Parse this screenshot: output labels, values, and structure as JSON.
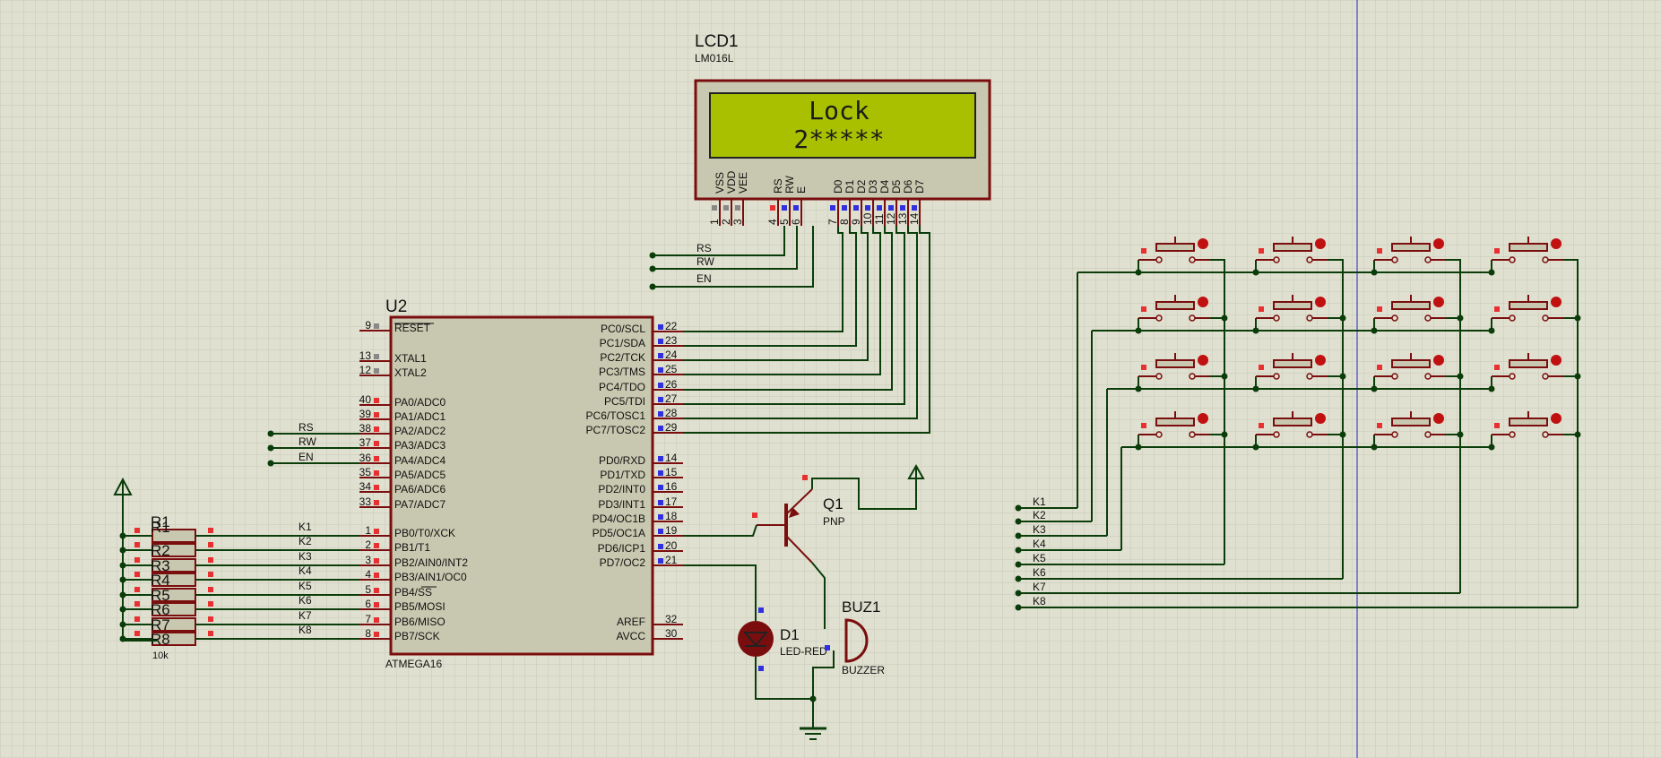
{
  "colors": {
    "background": "#e0e0d0",
    "grid": "#c9c9b8",
    "wire": "#0a3d0a",
    "component": "#7a0e0e",
    "chip_fill": "#c8c8b0",
    "lcd_screen": "#a8c000",
    "pin_red": "#e83030",
    "pin_blue": "#3030e0",
    "pin_gray": "#888888",
    "cursor_line": "#2222cc"
  },
  "lcd": {
    "ref": "LCD1",
    "part": "LM016L",
    "line1": "Lock",
    "line2": "2*****",
    "pin_names": [
      "VSS",
      "VDD",
      "VEE",
      "RS",
      "RW",
      "E",
      "D0",
      "D1",
      "D2",
      "D3",
      "D4",
      "D5",
      "D6",
      "D7"
    ],
    "pin_numbers": [
      "1",
      "2",
      "3",
      "4",
      "5",
      "6",
      "7",
      "8",
      "9",
      "10",
      "11",
      "12",
      "13",
      "14"
    ],
    "net_labels": [
      "RS",
      "RW",
      "EN"
    ]
  },
  "mcu": {
    "ref": "U2",
    "part": "ATMEGA16",
    "left_pins": [
      {
        "num": "9",
        "name": "RESET"
      },
      {
        "num": "13",
        "name": "XTAL1"
      },
      {
        "num": "12",
        "name": "XTAL2"
      },
      {
        "num": "40",
        "name": "PA0/ADC0"
      },
      {
        "num": "39",
        "name": "PA1/ADC1"
      },
      {
        "num": "38",
        "name": "PA2/ADC2"
      },
      {
        "num": "37",
        "name": "PA3/ADC3"
      },
      {
        "num": "36",
        "name": "PA4/ADC4"
      },
      {
        "num": "35",
        "name": "PA5/ADC5"
      },
      {
        "num": "34",
        "name": "PA6/ADC6"
      },
      {
        "num": "33",
        "name": "PA7/ADC7"
      },
      {
        "num": "1",
        "name": "PB0/T0/XCK"
      },
      {
        "num": "2",
        "name": "PB1/T1"
      },
      {
        "num": "3",
        "name": "PB2/AIN0/INT2"
      },
      {
        "num": "4",
        "name": "PB3/AIN1/OC0"
      },
      {
        "num": "5",
        "name": "PB4/SS"
      },
      {
        "num": "6",
        "name": "PB5/MOSI"
      },
      {
        "num": "7",
        "name": "PB6/MISO"
      },
      {
        "num": "8",
        "name": "PB7/SCK"
      }
    ],
    "right_pins": [
      {
        "num": "22",
        "name": "PC0/SCL"
      },
      {
        "num": "23",
        "name": "PC1/SDA"
      },
      {
        "num": "24",
        "name": "PC2/TCK"
      },
      {
        "num": "25",
        "name": "PC3/TMS"
      },
      {
        "num": "26",
        "name": "PC4/TDO"
      },
      {
        "num": "27",
        "name": "PC5/TDI"
      },
      {
        "num": "28",
        "name": "PC6/TOSC1"
      },
      {
        "num": "29",
        "name": "PC7/TOSC2"
      },
      {
        "num": "14",
        "name": "PD0/RXD"
      },
      {
        "num": "15",
        "name": "PD1/TXD"
      },
      {
        "num": "16",
        "name": "PD2/INT0"
      },
      {
        "num": "17",
        "name": "PD3/INT1"
      },
      {
        "num": "18",
        "name": "PD4/OC1B"
      },
      {
        "num": "19",
        "name": "PD5/OC1A"
      },
      {
        "num": "20",
        "name": "PD6/ICP1"
      },
      {
        "num": "21",
        "name": "PD7/OC2"
      },
      {
        "num": "32",
        "name": "AREF"
      },
      {
        "num": "30",
        "name": "AVCC"
      }
    ],
    "porta_nets": [
      "RS",
      "RW",
      "EN"
    ],
    "portb_nets": [
      "K1",
      "K2",
      "K3",
      "K4",
      "K5",
      "K6",
      "K7",
      "K8"
    ]
  },
  "resistors": {
    "refs": [
      "R1",
      "R2",
      "R3",
      "R4",
      "R5",
      "R6",
      "R7",
      "R8"
    ],
    "value": "10k"
  },
  "transistor": {
    "ref": "Q1",
    "type": "PNP"
  },
  "led": {
    "ref": "D1",
    "part": "LED-RED"
  },
  "buzzer": {
    "ref": "BUZ1",
    "part": "BUZZER"
  },
  "keypad": {
    "net_labels": [
      "K1",
      "K2",
      "K3",
      "K4",
      "K5",
      "K6",
      "K7",
      "K8"
    ],
    "rows": 4,
    "cols": 4
  }
}
